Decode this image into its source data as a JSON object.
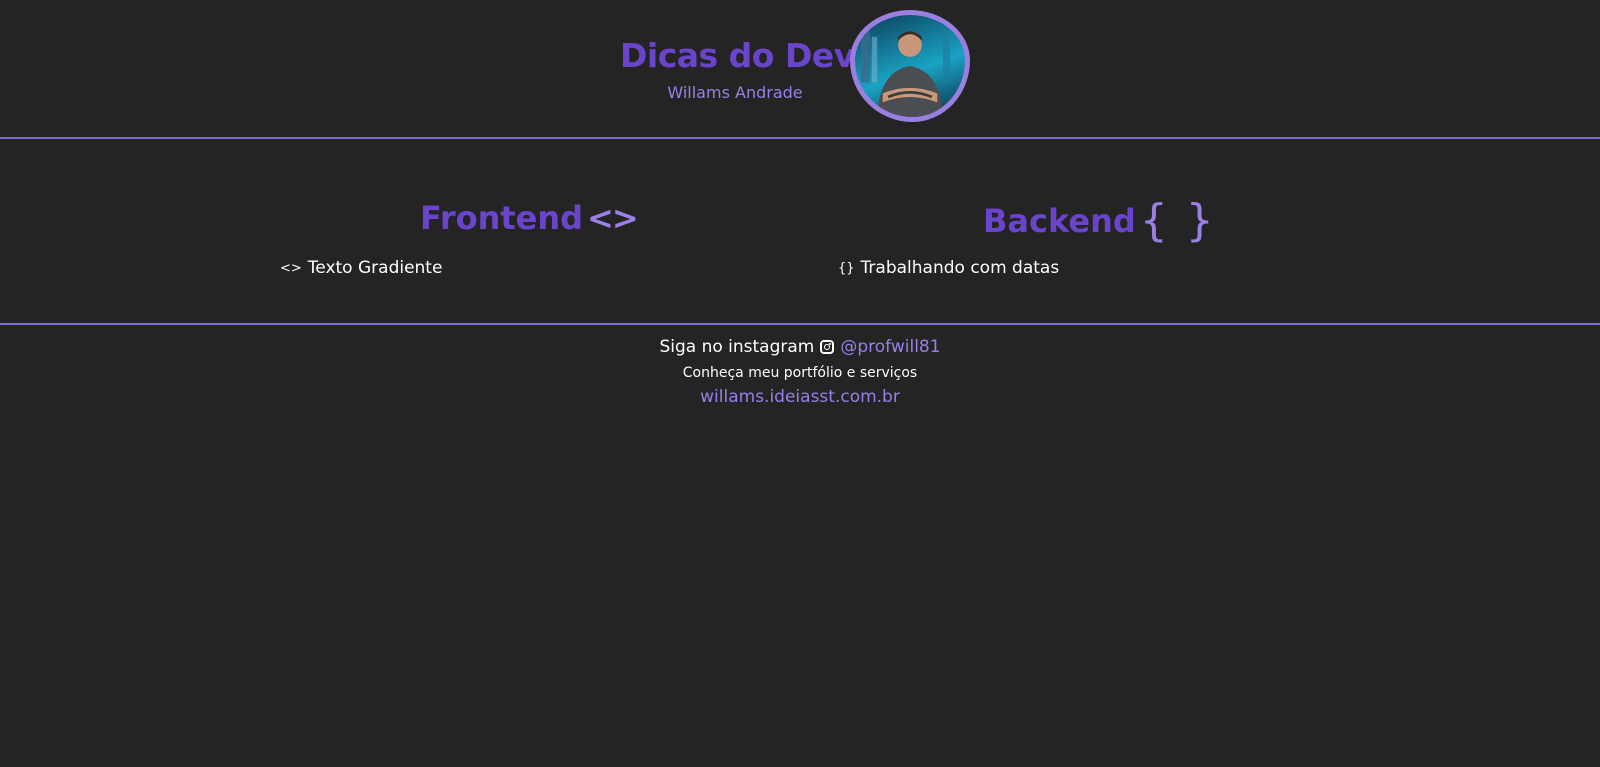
{
  "header": {
    "title": "Dicas do Dev",
    "subtitle": "Willams Andrade"
  },
  "frontend": {
    "heading": "Frontend",
    "heading_icon": "<>",
    "items": [
      {
        "icon": "<>",
        "label": "Texto Gradiente"
      }
    ]
  },
  "backend": {
    "heading": "Backend",
    "heading_icon": "{ }",
    "items": [
      {
        "icon": "{}",
        "label": "Trabalhando com datas"
      }
    ]
  },
  "footer": {
    "instagram_prefix": "Siga no instagram",
    "instagram_icon": "instagram-icon",
    "instagram_handle": "@profwill81",
    "portfolio_text": "Conheça meu portfólio e serviços",
    "portfolio_link": "willams.ideiasst.com.br"
  },
  "colors": {
    "background": "#242424",
    "title": "#6a45cc",
    "accent": "#9b7fe6",
    "divider": "#7a6fd0",
    "text": "#ffffff"
  }
}
